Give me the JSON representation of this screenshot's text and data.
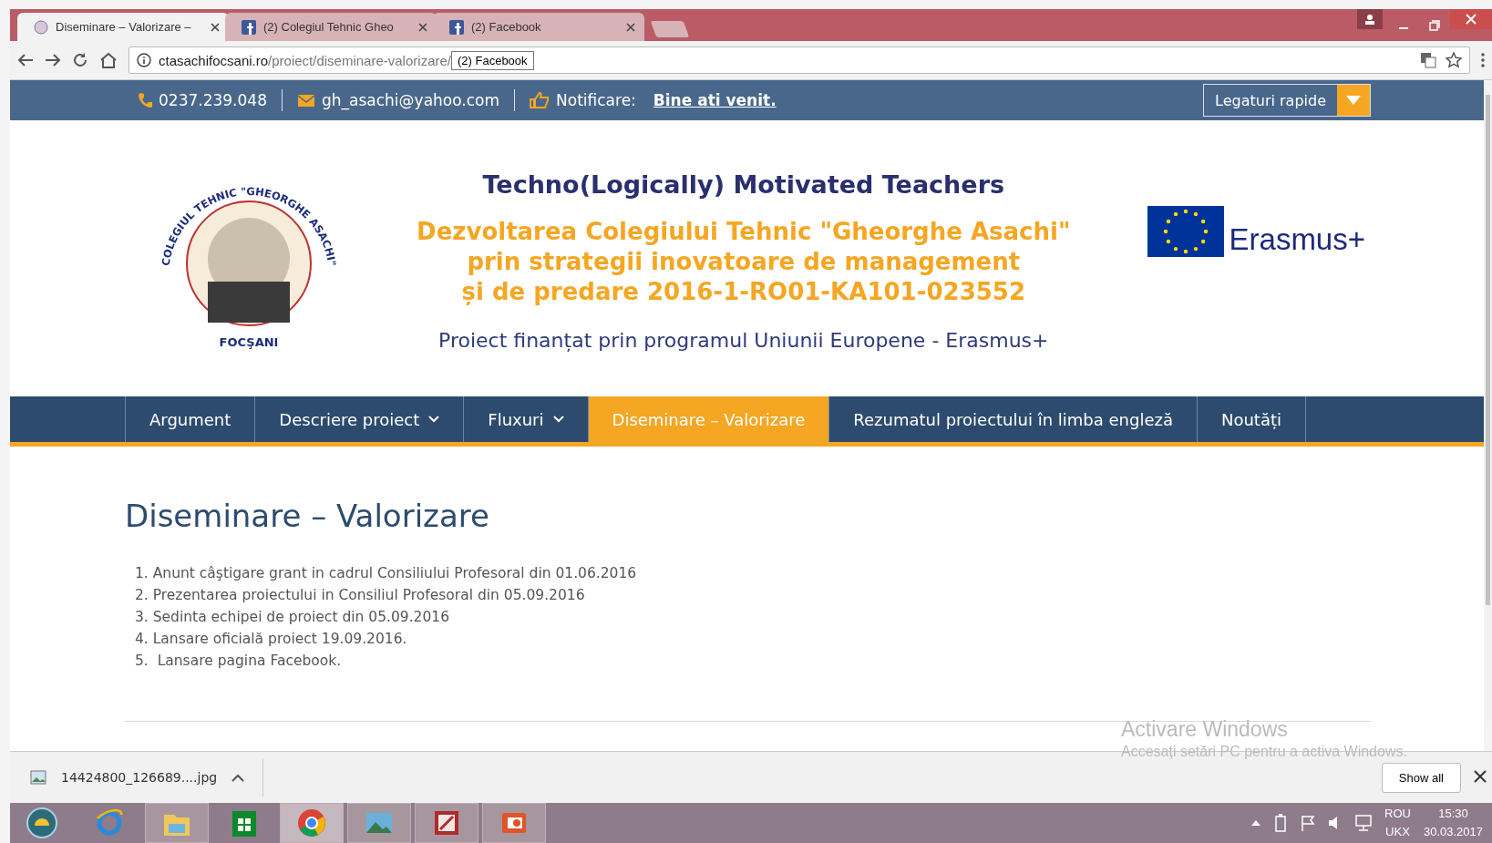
{
  "browser": {
    "tabs": [
      {
        "title": "Diseminare – Valorizare –",
        "kind": "portrait",
        "selected": true
      },
      {
        "title": "(2) Colegiul Tehnic Gheo",
        "kind": "social",
        "selected": false
      },
      {
        "title": "(2) Facebook",
        "kind": "social",
        "selected": false
      }
    ],
    "address": {
      "host": "ctasachifocsani.ro",
      "path": "/proiect/diseminare-valorizare/",
      "tooltip": "(2) Facebook"
    }
  },
  "topbar": {
    "phone": "0237.239.048",
    "email": "gh_asachi@yahoo.com",
    "notice_label": "Notificare:",
    "notice_link": "Bine ati venit.",
    "quick_links": "Legaturi rapide"
  },
  "header": {
    "logo_ring": "COLEGIUL TEHNIC \"GHEORGHE ASACHI\"",
    "logo_city": "FOCŞANI",
    "title": "Techno(Logically) Motivated Teachers",
    "project_lines": [
      "Dezvoltarea Colegiului Tehnic \"Gheorghe Asachi\"",
      "prin strategii inovatoare de management",
      "și de predare 2016-1-RO01-KA101-023552"
    ],
    "funding": "Proiect finanțat prin programul Uniunii Europene - Erasmus+",
    "erasmus": "Erasmus+"
  },
  "nav": [
    {
      "label": "Argument",
      "dropdown": false,
      "selected": false
    },
    {
      "label": "Descriere proiect",
      "dropdown": true,
      "selected": false
    },
    {
      "label": "Fluxuri",
      "dropdown": true,
      "selected": false
    },
    {
      "label": "Diseminare – Valorizare",
      "dropdown": false,
      "selected": true
    },
    {
      "label": "Rezumatul proiectului în limba engleză",
      "dropdown": false,
      "selected": false
    },
    {
      "label": "Noutăți",
      "dropdown": false,
      "selected": false
    }
  ],
  "content": {
    "heading": "Diseminare – Valorizare",
    "items": [
      {
        "number": "1.",
        "text": "Anunt câştigare grant in cadrul Consiliului Profesoral din 01.06.2016"
      },
      {
        "number": "2.",
        "text": "Prezentarea proiectului in Consiliul Profesoral din 05.09.2016"
      },
      {
        "number": "3.",
        "text": "Sedinta echipei de proiect din 05.09.2016"
      },
      {
        "number": "4.",
        "text": "Lansare oficială proiect 19.09.2016."
      },
      {
        "number": "5.",
        "text": " Lansare pagina Facebook."
      }
    ]
  },
  "activation": {
    "title": "Activare Windows",
    "text": "Accesați setări PC pentru a activa Windows."
  },
  "downloads": {
    "file": "14424800_126689....jpg",
    "show_all": "Show all"
  },
  "taskbar": {
    "apps": [
      {
        "kind": "start",
        "running": false,
        "selected": false
      },
      {
        "kind": "browser-e",
        "running": false,
        "selected": false
      },
      {
        "kind": "folder",
        "running": true,
        "selected": false
      },
      {
        "kind": "store",
        "running": false,
        "selected": false
      },
      {
        "kind": "chrome",
        "running": true,
        "selected": true
      },
      {
        "kind": "photos",
        "running": true,
        "selected": false
      },
      {
        "kind": "paint",
        "running": true,
        "selected": false
      },
      {
        "kind": "slides",
        "running": true,
        "selected": false
      }
    ],
    "language": [
      "ROU",
      "UKX"
    ],
    "time": "15:30",
    "date": "30.03.2017"
  }
}
